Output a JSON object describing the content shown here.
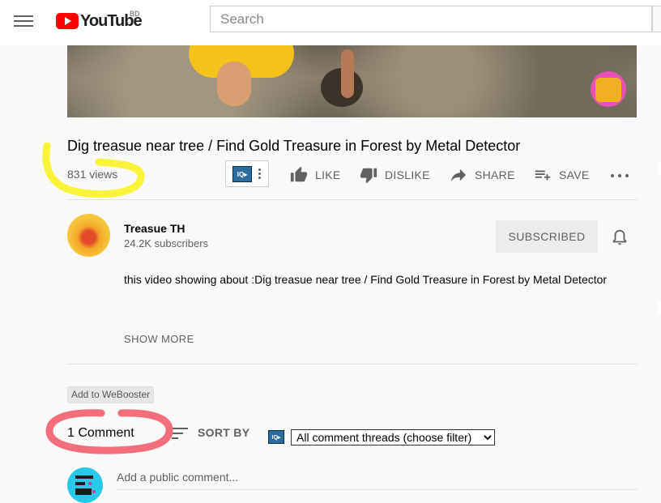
{
  "header": {
    "logo_text": "YouTube",
    "country_code": "BD",
    "search_placeholder": "Search"
  },
  "video": {
    "title": "Dig treasue near tree / Find Gold Treasure in Forest by Metal Detector",
    "views": "831 views",
    "actions": {
      "like": "LIKE",
      "dislike": "DISLIKE",
      "share": "SHARE",
      "save": "SAVE"
    }
  },
  "channel": {
    "name": "Treasue TH",
    "subscribers": "24.2K subscribers",
    "subscribe_label": "SUBSCRIBED"
  },
  "description": {
    "text": "this video showing about :Dig treasue near tree / Find Gold Treasure in Forest by Metal Detector",
    "show_more": "SHOW MORE"
  },
  "comments": {
    "webooster_label": "Add to WeBooster",
    "count_label": "1 Comment",
    "sort_label": "SORT BY",
    "filter_selected": "All comment threads (choose filter)",
    "add_placeholder": "Add a public comment..."
  },
  "colors": {
    "brand_red": "#ff0000",
    "highlight_yellow": "#f7f43a",
    "highlight_red": "#f26e7c",
    "muted_text": "#606060"
  },
  "icons": [
    "menu-icon",
    "youtube-logo-icon",
    "iq-extension-icon",
    "thumbs-up-icon",
    "thumbs-down-icon",
    "share-icon",
    "save-playlist-icon",
    "more-icon",
    "bell-icon",
    "sort-icon"
  ]
}
